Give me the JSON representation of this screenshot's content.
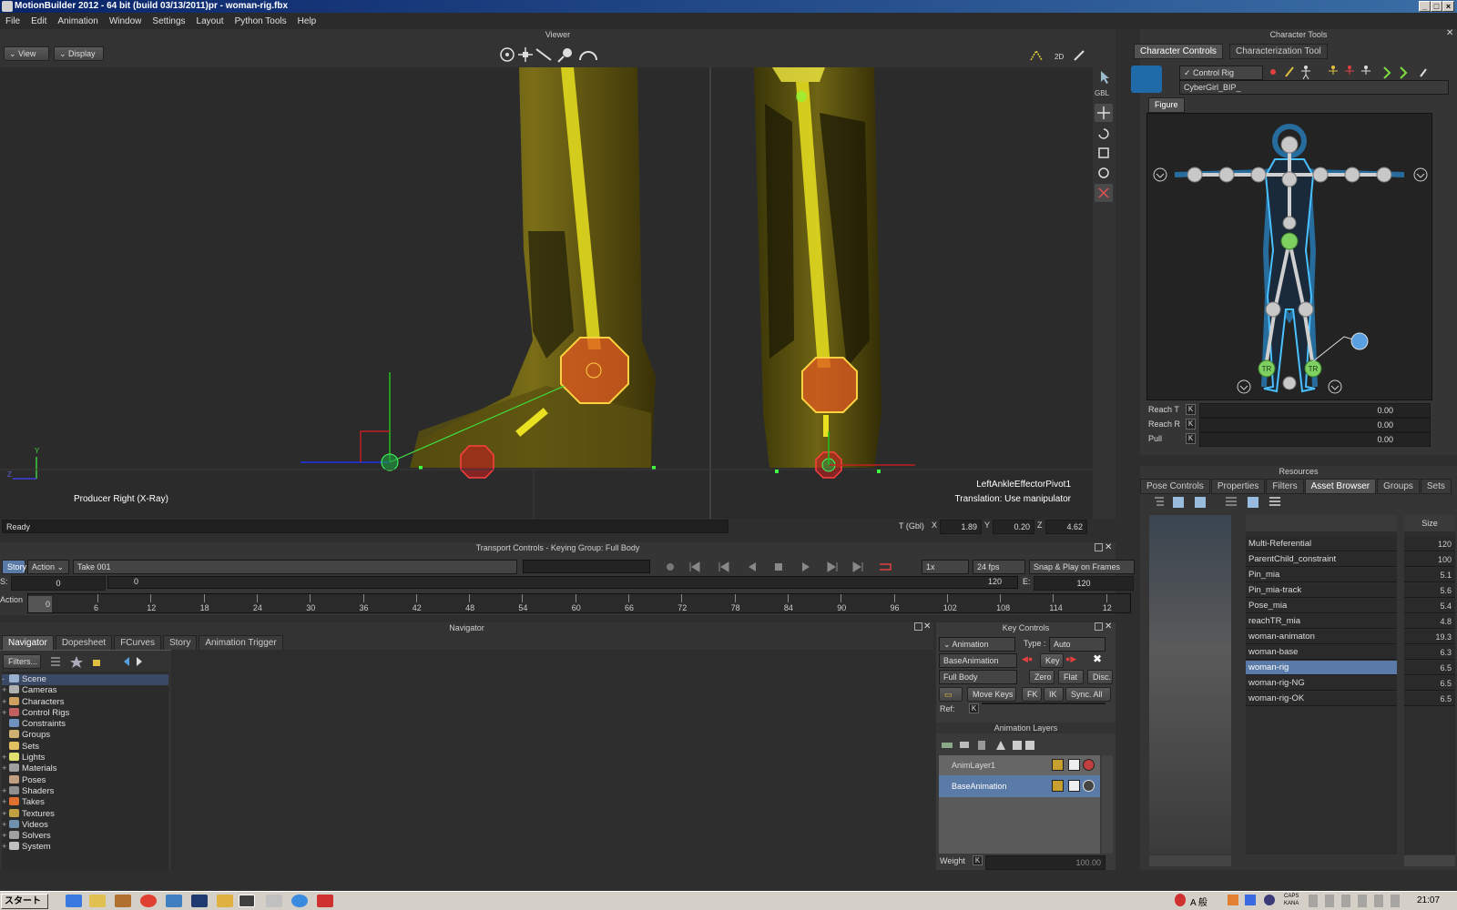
{
  "window": {
    "title": "MotionBuilder 2012  - 64 bit (build 03/13/2011)pr  - woman-rig.fbx",
    "controls": [
      "_",
      "□",
      "×"
    ]
  },
  "menu": [
    "File",
    "Edit",
    "Animation",
    "Window",
    "Settings",
    "Layout",
    "Python Tools",
    "Help"
  ],
  "viewer": {
    "title": "Viewer",
    "view_btn": "View",
    "display_btn": "Display",
    "camera_label": "Producer Right (X-Ray)",
    "overlay_line1": "LeftAnkleEffectorPivot1",
    "overlay_line2": "Translation: Use manipulator",
    "status": "Ready",
    "coord_label": "T (Gbl)",
    "x_label": "X",
    "x_value": "1.89",
    "y_label": "Y",
    "y_value": "0.20",
    "z_label": "Z",
    "z_value": "4.62",
    "side_label": "GBL",
    "axis_y": "Y",
    "axis_z": "Z"
  },
  "transport": {
    "title": "Transport Controls  -  Keying Group: Full Body",
    "story_btn": "Story",
    "action_dd": "Action",
    "take": "Take 001",
    "speed": "1x",
    "fps": "24 fps",
    "snap": "Snap & Play on Frames",
    "start_label": "S:",
    "start_value": "0",
    "cur_value": "0",
    "end_cur": "120",
    "end_label": "E:",
    "end_value": "120",
    "action_label": "Action",
    "frame_marker": "0",
    "ticks": [
      "6",
      "12",
      "18",
      "24",
      "30",
      "36",
      "42",
      "48",
      "54",
      "60",
      "66",
      "72",
      "78",
      "84",
      "90",
      "96",
      "102",
      "108",
      "114",
      "12"
    ]
  },
  "navigator": {
    "title": "Navigator",
    "tabs": [
      "Navigator",
      "Dopesheet",
      "FCurves",
      "Story",
      "Animation Trigger"
    ],
    "filters": "Filters...",
    "tree": [
      {
        "label": "Scene",
        "pm": "-",
        "color": "#9ab0d0"
      },
      {
        "label": "Cameras",
        "pm": "+",
        "color": "#b0b0b0"
      },
      {
        "label": "Characters",
        "pm": "+",
        "color": "#d0a060"
      },
      {
        "label": "Control Rigs",
        "pm": "+",
        "color": "#c06060"
      },
      {
        "label": "Constraints",
        "pm": "",
        "color": "#7090c0"
      },
      {
        "label": "Groups",
        "pm": "",
        "color": "#d0b070"
      },
      {
        "label": "Sets",
        "pm": "",
        "color": "#e0c060"
      },
      {
        "label": "Lights",
        "pm": "+",
        "color": "#e0e070"
      },
      {
        "label": "Materials",
        "pm": "+",
        "color": "#a0a0a0"
      },
      {
        "label": "Poses",
        "pm": "",
        "color": "#c0a080"
      },
      {
        "label": "Shaders",
        "pm": "+",
        "color": "#909090"
      },
      {
        "label": "Takes",
        "pm": "+",
        "color": "#e07030"
      },
      {
        "label": "Textures",
        "pm": "+",
        "color": "#c0a040"
      },
      {
        "label": "Videos",
        "pm": "+",
        "color": "#7090b0"
      },
      {
        "label": "Solvers",
        "pm": "+",
        "color": "#a0a0a0"
      },
      {
        "label": "System",
        "pm": "+",
        "color": "#c0c0c0"
      }
    ]
  },
  "keycontrols": {
    "title": "Key Controls",
    "animation": "Animation",
    "type_label": "Type :",
    "type_value": "Auto",
    "layer": "BaseAnimation",
    "key_btn": "Key",
    "body": "Full Body",
    "zero": "Zero",
    "flat": "Flat",
    "disc": "Disc.",
    "move_keys": "Move Keys",
    "fk": "FK",
    "ik": "IK",
    "sync": "Sync. All",
    "ref_label": "Ref:",
    "k": "K"
  },
  "layers": {
    "title": "Animation Layers",
    "items": [
      {
        "name": "AnimLayer1"
      },
      {
        "name": "BaseAnimation"
      }
    ],
    "weight_label": "Weight",
    "weight_value": "100.00"
  },
  "chartools": {
    "title": "Character Tools",
    "tabs": [
      "Character Controls",
      "Characterization Tool"
    ],
    "rig_label": "Control Rig",
    "character": "CyberGirl_BIP_",
    "figure_tab": "Figure",
    "tr": "TR",
    "sliders": [
      {
        "label": "Reach T",
        "k": "K",
        "value": "0.00"
      },
      {
        "label": "Reach R",
        "k": "K",
        "value": "0.00"
      },
      {
        "label": "Pull",
        "k": "K",
        "value": "0.00"
      }
    ]
  },
  "resources": {
    "title": "Resources",
    "tabs": [
      "Pose Controls",
      "Properties",
      "Filters",
      "Asset Browser",
      "Groups",
      "Sets"
    ],
    "size_header": "Size",
    "assets": [
      {
        "name": "Multi-Referential",
        "size": "120"
      },
      {
        "name": "ParentChild_constraint",
        "size": "100"
      },
      {
        "name": "Pin_mia",
        "size": "5.1"
      },
      {
        "name": "Pin_mia-track",
        "size": "5.6"
      },
      {
        "name": "Pose_mia",
        "size": "5.4"
      },
      {
        "name": "reachTR_mia",
        "size": "4.8"
      },
      {
        "name": "woman-animaton",
        "size": "19.3"
      },
      {
        "name": "woman-base",
        "size": "6.3"
      },
      {
        "name": "woman-rig",
        "size": "6.5"
      },
      {
        "name": "woman-rig-NG",
        "size": "6.5"
      },
      {
        "name": "woman-rig-OK",
        "size": "6.5"
      }
    ]
  },
  "taskbar": {
    "start": "スタート",
    "clock": "21:07",
    "ime": "A 般",
    "caps": "CAPS",
    "kana": "KANA"
  }
}
